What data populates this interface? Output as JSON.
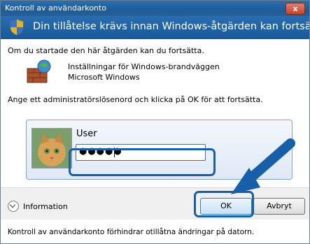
{
  "window": {
    "title": "Kontroll av användarkonto",
    "close_label": "x"
  },
  "banner": {
    "headline": "Din tillåtelse krävs innan Windows-åtgärden kan fortsätta"
  },
  "intro_text": "Om du startade den här åtgärden kan du fortsätta.",
  "program": {
    "name": "Inställningar för Windows-brandväggen",
    "publisher": "Microsoft Windows"
  },
  "prompt_text": "Ange ett administratörslösenord och klicka på OK för att fortsätta.",
  "credentials": {
    "username": "User",
    "password_masked": "●●●●●"
  },
  "details": {
    "label": "Information"
  },
  "buttons": {
    "ok": "OK",
    "cancel": "Avbryt"
  },
  "status": {
    "text": "Kontroll av användarkonto förhindrar otillåtna ändringar på datorn."
  },
  "colors": {
    "accent": "#1760a9",
    "titlebar": "#2c6fb0"
  }
}
